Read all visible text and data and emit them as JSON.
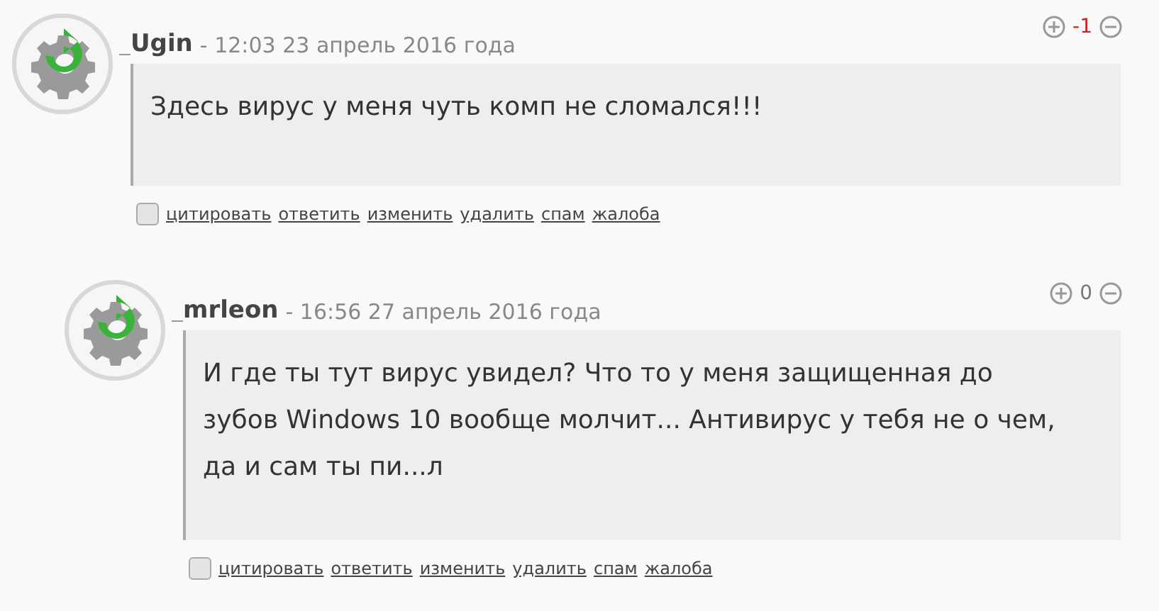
{
  "comments": [
    {
      "author": "Ugin",
      "date": "- 12:03 23 апрель 2016 года",
      "score": "-1",
      "color": "#cc2222",
      "text": "Здесь вирус у меня чуть комп не сломался!!!",
      "checked": false,
      "actions": [
        "цитировать",
        "ответить",
        "изменить",
        "удалить",
        "спам",
        "жалоба"
      ],
      "children": [
        {
          "author": "mrleon",
          "date": "- 16:56 27 апрель 2016 года",
          "score": "0",
          "color": "#777777",
          "text": "И где ты тут вирус увидел? Что то у меня защищенная до зубов Windows 10 вообще молчит... Антивирус у тебя не о чем, да и сам ты пи...л",
          "checked": false,
          "actions": [
            "цитировать",
            "ответить",
            "изменить",
            "удалить",
            "спам",
            "жалоба"
          ]
        }
      ]
    }
  ]
}
